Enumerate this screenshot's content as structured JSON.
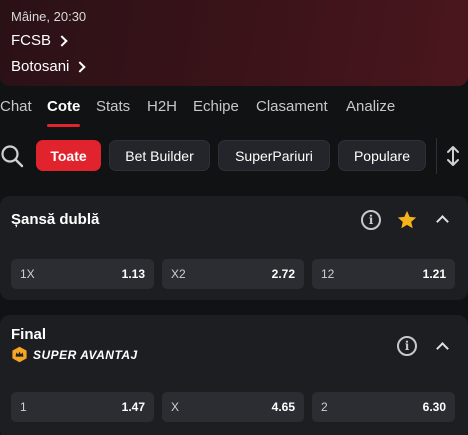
{
  "match": {
    "time": "Mâine, 20:30",
    "home_team": "FCSB",
    "away_team": "Botosani"
  },
  "tabs": [
    {
      "label": "Chat"
    },
    {
      "label": "Cote"
    },
    {
      "label": "Stats"
    },
    {
      "label": "H2H"
    },
    {
      "label": "Echipe"
    },
    {
      "label": "Clasament"
    },
    {
      "label": "Analize"
    }
  ],
  "active_tab": "Cote",
  "filters": [
    {
      "label": "Toate"
    },
    {
      "label": "Bet Builder"
    },
    {
      "label": "SuperPariuri"
    },
    {
      "label": "Populare"
    }
  ],
  "active_filter": "Toate",
  "markets": [
    {
      "title": "Șansă dublă",
      "favorited": true,
      "odds": [
        {
          "label": "1X",
          "value": "1.13"
        },
        {
          "label": "X2",
          "value": "2.72"
        },
        {
          "label": "12",
          "value": "1.21"
        }
      ]
    },
    {
      "title": "Final",
      "promo": "SUPER AVANTAJ",
      "odds": [
        {
          "label": "1",
          "value": "1.47"
        },
        {
          "label": "X",
          "value": "4.65"
        },
        {
          "label": "2",
          "value": "6.30"
        }
      ]
    }
  ],
  "icons": {
    "info": "i",
    "accent": "#e1232e",
    "star": "#f5b21a"
  }
}
